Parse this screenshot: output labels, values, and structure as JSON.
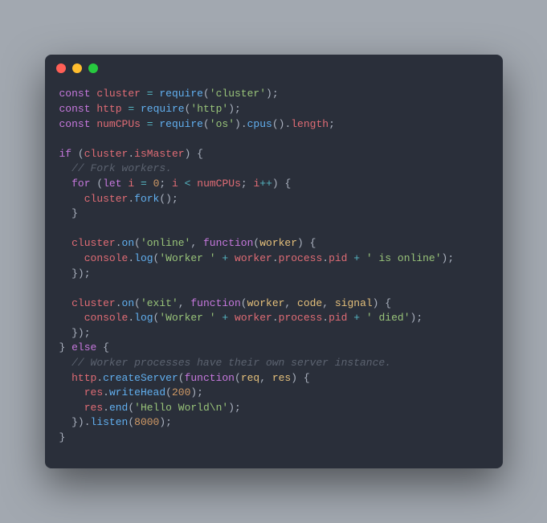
{
  "window": {
    "buttons": [
      "close",
      "minimize",
      "zoom"
    ]
  },
  "code": {
    "tokens": [
      [
        [
          "kw",
          "const"
        ],
        [
          "plain",
          " "
        ],
        [
          "name",
          "cluster"
        ],
        [
          "plain",
          " "
        ],
        [
          "op",
          "="
        ],
        [
          "plain",
          " "
        ],
        [
          "func",
          "require"
        ],
        [
          "plain",
          "("
        ],
        [
          "str",
          "'cluster'"
        ],
        [
          "plain",
          ");"
        ]
      ],
      [
        [
          "kw",
          "const"
        ],
        [
          "plain",
          " "
        ],
        [
          "name",
          "http"
        ],
        [
          "plain",
          " "
        ],
        [
          "op",
          "="
        ],
        [
          "plain",
          " "
        ],
        [
          "func",
          "require"
        ],
        [
          "plain",
          "("
        ],
        [
          "str",
          "'http'"
        ],
        [
          "plain",
          ");"
        ]
      ],
      [
        [
          "kw",
          "const"
        ],
        [
          "plain",
          " "
        ],
        [
          "name",
          "numCPUs"
        ],
        [
          "plain",
          " "
        ],
        [
          "op",
          "="
        ],
        [
          "plain",
          " "
        ],
        [
          "func",
          "require"
        ],
        [
          "plain",
          "("
        ],
        [
          "str",
          "'os'"
        ],
        [
          "plain",
          ")."
        ],
        [
          "func",
          "cpus"
        ],
        [
          "plain",
          "()."
        ],
        [
          "name",
          "length"
        ],
        [
          "plain",
          ";"
        ]
      ],
      [],
      [
        [
          "kw",
          "if"
        ],
        [
          "plain",
          " ("
        ],
        [
          "name",
          "cluster"
        ],
        [
          "plain",
          "."
        ],
        [
          "name",
          "isMaster"
        ],
        [
          "plain",
          ") {"
        ]
      ],
      [
        [
          "plain",
          "  "
        ],
        [
          "cmt",
          "// Fork workers."
        ]
      ],
      [
        [
          "plain",
          "  "
        ],
        [
          "kw",
          "for"
        ],
        [
          "plain",
          " ("
        ],
        [
          "kw",
          "let"
        ],
        [
          "plain",
          " "
        ],
        [
          "name",
          "i"
        ],
        [
          "plain",
          " "
        ],
        [
          "op",
          "="
        ],
        [
          "plain",
          " "
        ],
        [
          "num",
          "0"
        ],
        [
          "plain",
          "; "
        ],
        [
          "name",
          "i"
        ],
        [
          "plain",
          " "
        ],
        [
          "op",
          "<"
        ],
        [
          "plain",
          " "
        ],
        [
          "name",
          "numCPUs"
        ],
        [
          "plain",
          "; "
        ],
        [
          "name",
          "i"
        ],
        [
          "op",
          "++"
        ],
        [
          "plain",
          ") {"
        ]
      ],
      [
        [
          "plain",
          "    "
        ],
        [
          "name",
          "cluster"
        ],
        [
          "plain",
          "."
        ],
        [
          "func",
          "fork"
        ],
        [
          "plain",
          "();"
        ]
      ],
      [
        [
          "plain",
          "  }"
        ]
      ],
      [],
      [
        [
          "plain",
          "  "
        ],
        [
          "name",
          "cluster"
        ],
        [
          "plain",
          "."
        ],
        [
          "func",
          "on"
        ],
        [
          "plain",
          "("
        ],
        [
          "str",
          "'online'"
        ],
        [
          "plain",
          ", "
        ],
        [
          "kw",
          "function"
        ],
        [
          "plain",
          "("
        ],
        [
          "param",
          "worker"
        ],
        [
          "plain",
          ") {"
        ]
      ],
      [
        [
          "plain",
          "    "
        ],
        [
          "name",
          "console"
        ],
        [
          "plain",
          "."
        ],
        [
          "func",
          "log"
        ],
        [
          "plain",
          "("
        ],
        [
          "str",
          "'Worker '"
        ],
        [
          "plain",
          " "
        ],
        [
          "op",
          "+"
        ],
        [
          "plain",
          " "
        ],
        [
          "name",
          "worker"
        ],
        [
          "plain",
          "."
        ],
        [
          "name",
          "process"
        ],
        [
          "plain",
          "."
        ],
        [
          "name",
          "pid"
        ],
        [
          "plain",
          " "
        ],
        [
          "op",
          "+"
        ],
        [
          "plain",
          " "
        ],
        [
          "str",
          "' is online'"
        ],
        [
          "plain",
          ");"
        ]
      ],
      [
        [
          "plain",
          "  });"
        ]
      ],
      [],
      [
        [
          "plain",
          "  "
        ],
        [
          "name",
          "cluster"
        ],
        [
          "plain",
          "."
        ],
        [
          "func",
          "on"
        ],
        [
          "plain",
          "("
        ],
        [
          "str",
          "'exit'"
        ],
        [
          "plain",
          ", "
        ],
        [
          "kw",
          "function"
        ],
        [
          "plain",
          "("
        ],
        [
          "param",
          "worker"
        ],
        [
          "plain",
          ", "
        ],
        [
          "param",
          "code"
        ],
        [
          "plain",
          ", "
        ],
        [
          "param",
          "signal"
        ],
        [
          "plain",
          ") {"
        ]
      ],
      [
        [
          "plain",
          "    "
        ],
        [
          "name",
          "console"
        ],
        [
          "plain",
          "."
        ],
        [
          "func",
          "log"
        ],
        [
          "plain",
          "("
        ],
        [
          "str",
          "'Worker '"
        ],
        [
          "plain",
          " "
        ],
        [
          "op",
          "+"
        ],
        [
          "plain",
          " "
        ],
        [
          "name",
          "worker"
        ],
        [
          "plain",
          "."
        ],
        [
          "name",
          "process"
        ],
        [
          "plain",
          "."
        ],
        [
          "name",
          "pid"
        ],
        [
          "plain",
          " "
        ],
        [
          "op",
          "+"
        ],
        [
          "plain",
          " "
        ],
        [
          "str",
          "' died'"
        ],
        [
          "plain",
          ");"
        ]
      ],
      [
        [
          "plain",
          "  });"
        ]
      ],
      [
        [
          "plain",
          "} "
        ],
        [
          "kw",
          "else"
        ],
        [
          "plain",
          " {"
        ]
      ],
      [
        [
          "plain",
          "  "
        ],
        [
          "cmt",
          "// Worker processes have their own server instance."
        ]
      ],
      [
        [
          "plain",
          "  "
        ],
        [
          "name",
          "http"
        ],
        [
          "plain",
          "."
        ],
        [
          "func",
          "createServer"
        ],
        [
          "plain",
          "("
        ],
        [
          "kw",
          "function"
        ],
        [
          "plain",
          "("
        ],
        [
          "param",
          "req"
        ],
        [
          "plain",
          ", "
        ],
        [
          "param",
          "res"
        ],
        [
          "plain",
          ") {"
        ]
      ],
      [
        [
          "plain",
          "    "
        ],
        [
          "name",
          "res"
        ],
        [
          "plain",
          "."
        ],
        [
          "func",
          "writeHead"
        ],
        [
          "plain",
          "("
        ],
        [
          "num",
          "200"
        ],
        [
          "plain",
          ");"
        ]
      ],
      [
        [
          "plain",
          "    "
        ],
        [
          "name",
          "res"
        ],
        [
          "plain",
          "."
        ],
        [
          "func",
          "end"
        ],
        [
          "plain",
          "("
        ],
        [
          "str",
          "'Hello World\\n'"
        ],
        [
          "plain",
          ");"
        ]
      ],
      [
        [
          "plain",
          "  })."
        ],
        [
          "func",
          "listen"
        ],
        [
          "plain",
          "("
        ],
        [
          "num",
          "8000"
        ],
        [
          "plain",
          ");"
        ]
      ],
      [
        [
          "plain",
          "}"
        ]
      ]
    ]
  }
}
